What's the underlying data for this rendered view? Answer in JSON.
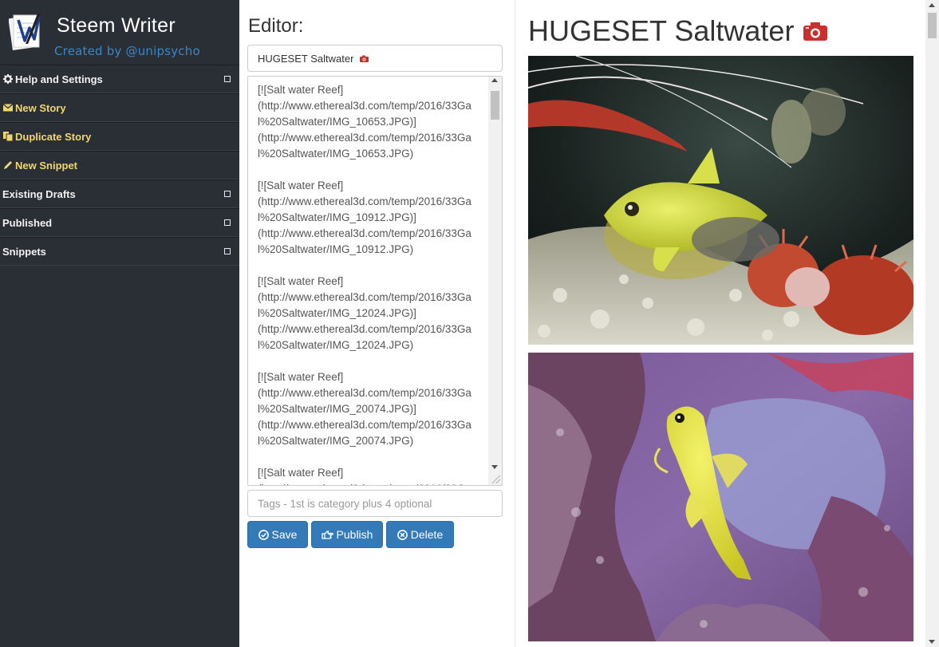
{
  "app": {
    "title": "Steem Writer",
    "subtitle": "Created by @unipsycho",
    "logo_icon": "quill-logo-icon"
  },
  "sidebar": {
    "items": [
      {
        "label": "Help and Settings",
        "icon": "gear-icon",
        "expandable": true,
        "color": "#f1f1f1"
      },
      {
        "label": "New Story",
        "icon": "envelope-icon",
        "expandable": false,
        "color": "#f0d66e"
      },
      {
        "label": "Duplicate Story",
        "icon": "copy-icon",
        "expandable": false,
        "color": "#f0d66e"
      },
      {
        "label": "New Snippet",
        "icon": "pencil-icon",
        "expandable": false,
        "color": "#f0d66e"
      },
      {
        "label": "Existing Drafts",
        "icon": "",
        "expandable": true,
        "color": "#f1f1f1"
      },
      {
        "label": "Published",
        "icon": "",
        "expandable": true,
        "color": "#f1f1f1"
      },
      {
        "label": "Snippets",
        "icon": "",
        "expandable": true,
        "color": "#f1f1f1"
      }
    ]
  },
  "editor": {
    "heading": "Editor:",
    "title_value": "HUGESET Saltwater",
    "title_icon": "camera-icon",
    "body_value": "[![Salt water Reef]\n(http://www.ethereal3d.com/temp/2016/33Gal%20Saltwater/IMG_10653.JPG)]\n(http://www.ethereal3d.com/temp/2016/33Gal%20Saltwater/IMG_10653.JPG)\n\n[![Salt water Reef]\n(http://www.ethereal3d.com/temp/2016/33Gal%20Saltwater/IMG_10912.JPG)]\n(http://www.ethereal3d.com/temp/2016/33Gal%20Saltwater/IMG_10912.JPG)\n\n[![Salt water Reef]\n(http://www.ethereal3d.com/temp/2016/33Gal%20Saltwater/IMG_12024.JPG)]\n(http://www.ethereal3d.com/temp/2016/33Gal%20Saltwater/IMG_12024.JPG)\n\n[![Salt water Reef]\n(http://www.ethereal3d.com/temp/2016/33Gal%20Saltwater/IMG_20074.JPG)]\n(http://www.ethereal3d.com/temp/2016/33Gal%20Saltwater/IMG_20074.JPG)\n\n[![Salt water Reef]\n(http://www.ethereal3d.com/temp/2016/33G",
    "tags_placeholder": "Tags - 1st is category plus 4 optional",
    "buttons": {
      "save": "Save",
      "publish": "Publish",
      "delete": "Delete"
    },
    "accent": "#337ab7"
  },
  "preview": {
    "title": "HUGESET Saltwater",
    "title_icon": "camera-icon",
    "images": [
      {
        "alt": "Salt water Reef"
      },
      {
        "alt": "Salt water Reef"
      }
    ]
  }
}
